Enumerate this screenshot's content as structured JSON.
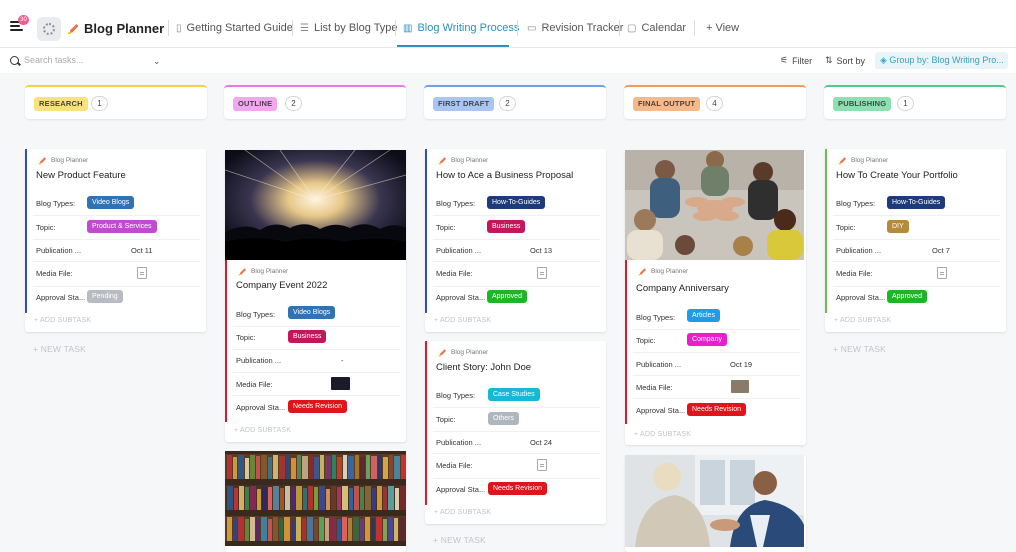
{
  "header": {
    "notif_count": "30",
    "title": "Blog Planner",
    "tabs": [
      {
        "label": "Getting Started Guide",
        "icon": "doc-icon"
      },
      {
        "label": "List by Blog Type",
        "icon": "list-icon"
      },
      {
        "label": "Blog Writing Process",
        "icon": "board-icon"
      },
      {
        "label": "Revision Tracker",
        "icon": "table-icon"
      },
      {
        "label": "Calendar",
        "icon": "calendar-icon"
      },
      {
        "label": "+ View",
        "icon": "plus-icon"
      }
    ]
  },
  "toolbar": {
    "search_placeholder": "Search tasks...",
    "filter": "Filter",
    "sort": "Sort by",
    "group": "Group by: Blog Writing Pro..."
  },
  "fields": {
    "blog_types": "Blog Types:",
    "topic": "Topic:",
    "publication": "Publication ...",
    "media": "Media File:",
    "approval": "Approval Sta...",
    "add_subtask": "+ ADD SUBTASK",
    "new_task": "+ NEW TASK",
    "list": "Blog Planner"
  },
  "columns": [
    {
      "name": "RESEARCH",
      "count": "1",
      "color": "#f7e27e",
      "accent": "#f4d13e"
    },
    {
      "name": "OUTLINE",
      "count": "2",
      "color": "#f3a6f0",
      "accent": "#e87ae6"
    },
    {
      "name": "FIRST DRAFT",
      "count": "2",
      "color": "#a9c5f2",
      "accent": "#6f9fe8"
    },
    {
      "name": "FINAL OUTPUT",
      "count": "4",
      "color": "#f8b98a",
      "accent": "#f29a5c"
    },
    {
      "name": "PUBLISHING",
      "count": "1",
      "color": "#8ee0b0",
      "accent": "#54c98b"
    }
  ],
  "cards": {
    "c1": {
      "title": "New Product Feature",
      "type": "Video Blogs",
      "topic": "Product & Services",
      "date": "Oct 11",
      "approval": "Pending"
    },
    "c2": {
      "title": "Company Event 2022",
      "type": "Video Blogs",
      "topic": "Business",
      "date": "-",
      "approval": "Needs Revision"
    },
    "c3": {
      "title": "How to Ace a Business Proposal",
      "type": "How-To-Guides",
      "topic": "Business",
      "date": "Oct 13",
      "approval": "Approved"
    },
    "c4": {
      "title": "Client Story: John Doe",
      "type": "Case Studies",
      "topic": "Others",
      "date": "Oct 24",
      "approval": "Needs Revision"
    },
    "c5": {
      "title": "Company Anniversary",
      "type": "Articles",
      "topic": "Company",
      "date": "Oct 19",
      "approval": "Needs Revision"
    },
    "c6": {
      "title": "How To Create Your Portfolio",
      "type": "How-To-Guides",
      "topic": "DIY",
      "date": "Oct 7",
      "approval": "Approved"
    }
  },
  "colors": {
    "video_blogs": "#2f73b5",
    "product": "#c04bd0",
    "business": "#c2185b",
    "howto": "#1d3b7a",
    "case": "#17b8d4",
    "others": "#b0b6bd",
    "articles": "#1e9be9",
    "company": "#e91ece",
    "diy": "#b58a3c",
    "pending": "#b8bcc2",
    "approved": "#1fb626",
    "needs": "#e0141b"
  }
}
